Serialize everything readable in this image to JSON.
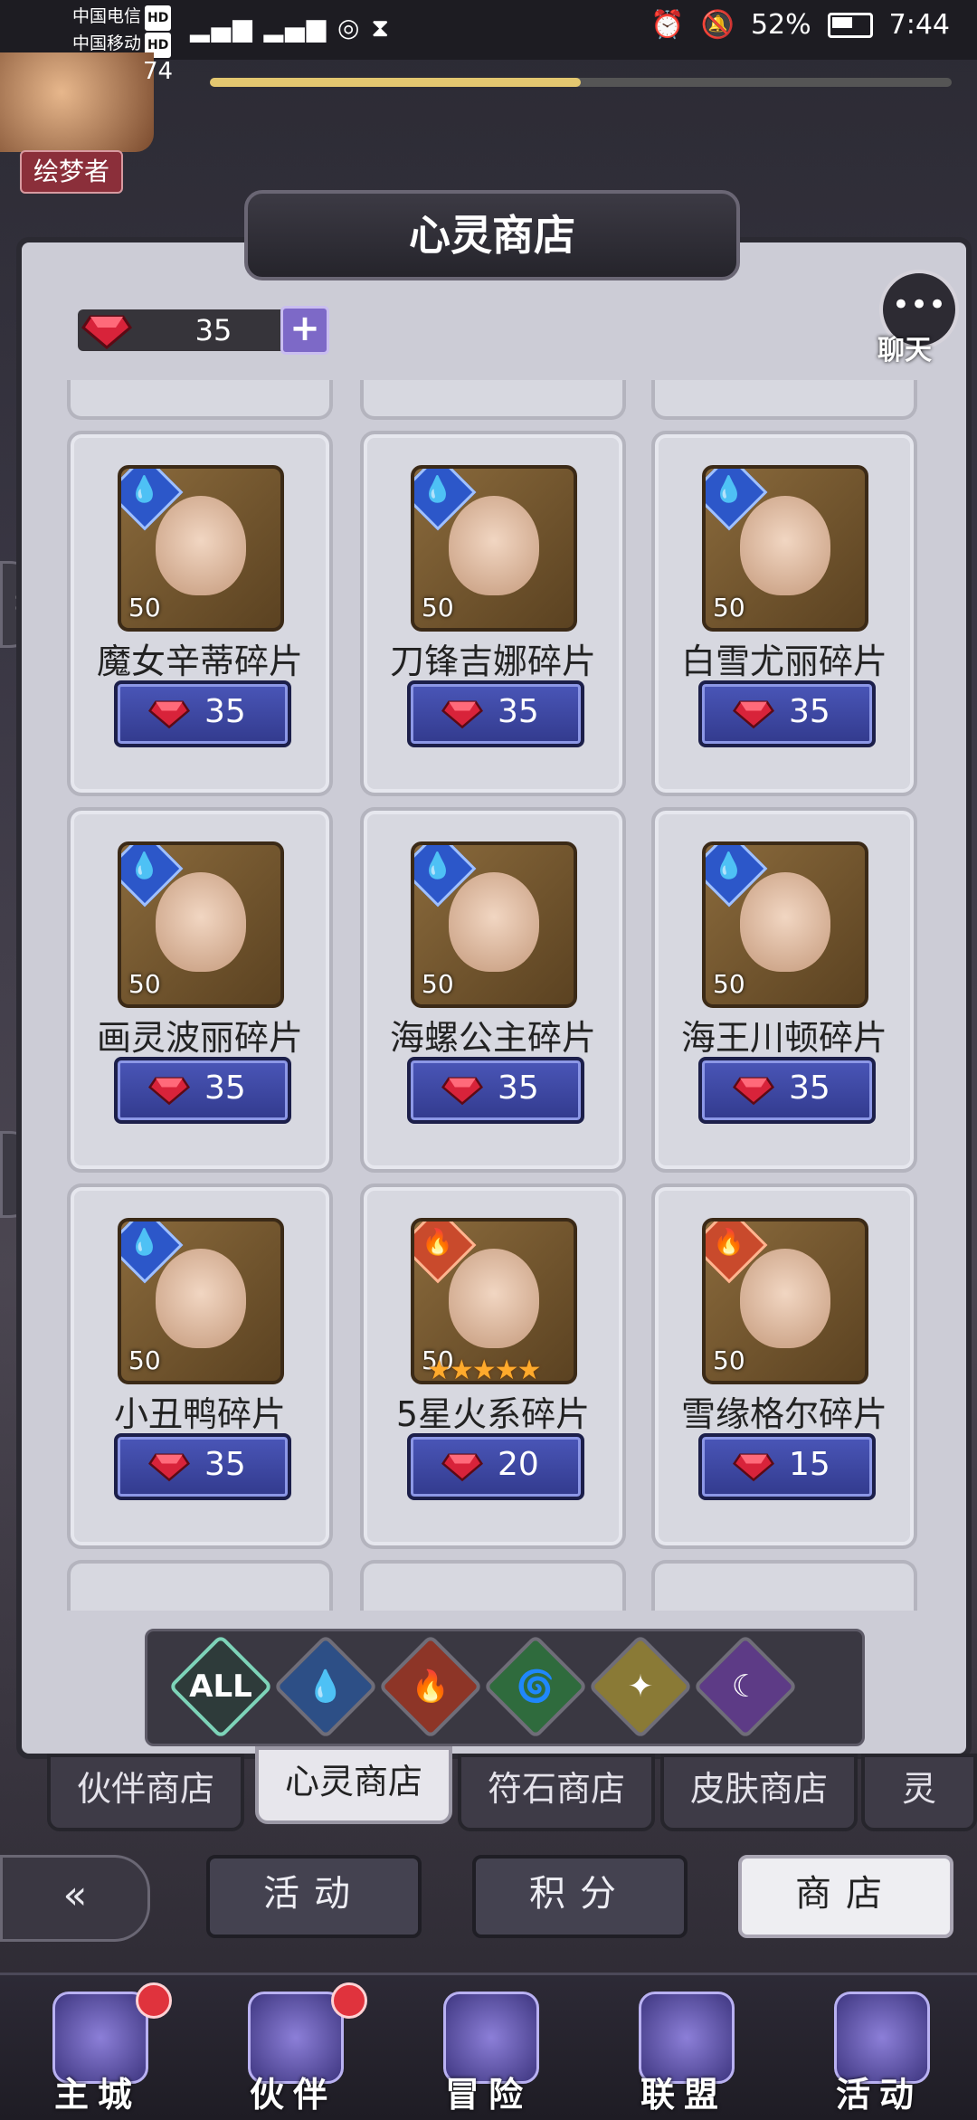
{
  "status": {
    "carrier1": "中国电信",
    "carrier2": "中国移动",
    "hd": "HD",
    "net": "4G",
    "battery": "52%",
    "time": "7:44"
  },
  "hud": {
    "level": "74",
    "xp_fraction": 0.5,
    "rank_badge": "绘梦者"
  },
  "shop": {
    "title": "心灵商店",
    "chat_label": "聊天",
    "currency_value": "35",
    "currency_plus": "+",
    "items": [
      {
        "name": "魔女辛蒂碎片",
        "count": "50",
        "price": "35",
        "element": "water",
        "stars": 0
      },
      {
        "name": "刀锋吉娜碎片",
        "count": "50",
        "price": "35",
        "element": "water",
        "stars": 0
      },
      {
        "name": "白雪尤丽碎片",
        "count": "50",
        "price": "35",
        "element": "water",
        "stars": 0
      },
      {
        "name": "画灵波丽碎片",
        "count": "50",
        "price": "35",
        "element": "water",
        "stars": 0
      },
      {
        "name": "海螺公主碎片",
        "count": "50",
        "price": "35",
        "element": "water",
        "stars": 0
      },
      {
        "name": "海王川顿碎片",
        "count": "50",
        "price": "35",
        "element": "water",
        "stars": 0
      },
      {
        "name": "小丑鸭碎片",
        "count": "50",
        "price": "35",
        "element": "water",
        "stars": 0
      },
      {
        "name": "5星火系碎片",
        "count": "50",
        "price": "20",
        "element": "fire",
        "stars": 5
      },
      {
        "name": "雪缘格尔碎片",
        "count": "50",
        "price": "15",
        "element": "fire",
        "stars": 0
      }
    ],
    "filters": [
      {
        "name": "all",
        "label": "ALL"
      },
      {
        "name": "water",
        "label": "💧"
      },
      {
        "name": "fire",
        "label": "🔥"
      },
      {
        "name": "wind",
        "label": "🌀"
      },
      {
        "name": "light",
        "label": "✦"
      },
      {
        "name": "dark",
        "label": "☾"
      }
    ],
    "tabs": [
      {
        "label": "伙伴商店",
        "active": false
      },
      {
        "label": "心灵商店",
        "active": true
      },
      {
        "label": "符石商店",
        "active": false
      },
      {
        "label": "皮肤商店",
        "active": false
      },
      {
        "label": "灵",
        "active": false
      }
    ]
  },
  "subnav": {
    "back": "«",
    "activity": "活动",
    "points": "积分",
    "store": "商店"
  },
  "nav": [
    {
      "label": "主城",
      "dot": true
    },
    {
      "label": "伙伴",
      "dot": true
    },
    {
      "label": "冒险",
      "dot": false
    },
    {
      "label": "联盟",
      "dot": false
    },
    {
      "label": "活动",
      "dot": false
    }
  ]
}
